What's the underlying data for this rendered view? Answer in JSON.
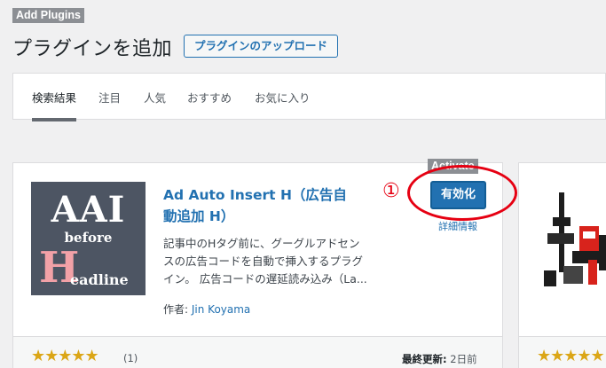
{
  "overlay": {
    "add_plugins_label": "Add Plugins",
    "activate_label": "Activate",
    "annotation_number": "①"
  },
  "header": {
    "title": "プラグインを追加",
    "upload_button": "プラグインのアップロード"
  },
  "filter_tabs": [
    {
      "label": "検索結果",
      "current": true
    },
    {
      "label": "注目",
      "current": false
    },
    {
      "label": "人気",
      "current": false
    },
    {
      "label": "おすすめ",
      "current": false
    },
    {
      "label": "お気に入り",
      "current": false
    }
  ],
  "plugin_card": {
    "thumbnail": {
      "line1": "AAI",
      "line2": "before",
      "initial": "H",
      "rest": "eadline"
    },
    "title_line1": "Ad Auto Insert H（広告自",
    "title_line2": "動追加 H）",
    "activate_button": "有効化",
    "more_details": "詳細情報",
    "description_lines": [
      "記事中のHタグ前に、グーグルアドセン",
      "スの広告コードを自動で挿入するプラグ",
      "イン。 広告コードの遅延読み込み（La..."
    ],
    "author_label": "作者:",
    "author_name": "Jin Koyama",
    "rating_stars": 5,
    "stars_text": "★★★★★",
    "rating_count": "(1)",
    "last_updated_label": "最終更新:",
    "last_updated_value": "2日前"
  },
  "second_card": {
    "stars_text": "★★★★★"
  },
  "colors": {
    "accent": "#2271b1",
    "annotation": "#e60012",
    "star": "#dba617",
    "thumb_bg": "#4d5563"
  }
}
